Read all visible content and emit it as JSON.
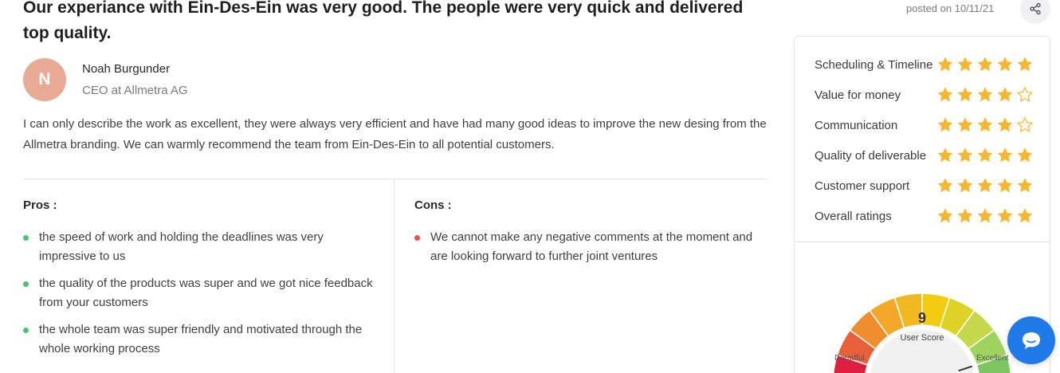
{
  "review": {
    "title": "Our experiance with Ein-Des-Ein was very good. The people were very quick and delivered top quality.",
    "posted": "posted on 10/11/21",
    "author": {
      "initial": "N",
      "name": "Noah Burgunder",
      "role": "CEO at Allmetra AG"
    },
    "body": "I can only describe the work as excellent, they were always very efficient and have had many good ideas to improve the new desing from the Allmetra branding. We can warmly recommend the team from Ein-Des-Ein to all potential customers.",
    "pros_title": "Pros :",
    "pros": [
      "the speed of work and holding the deadlines was very impressive to us",
      "the quality of the products was super and we got nice feedback from your customers",
      "the whole team was super friendly and motivated through the whole working process"
    ],
    "cons_title": "Cons :",
    "cons": [
      "We cannot make any negative comments at the moment and are looking forward to further joint ventures"
    ]
  },
  "ratings": [
    {
      "label": "Scheduling & Timeline",
      "stars": 5
    },
    {
      "label": "Value for money",
      "stars": 4
    },
    {
      "label": "Communication",
      "stars": 4
    },
    {
      "label": "Quality of deliverable",
      "stars": 5
    },
    {
      "label": "Customer support",
      "stars": 5
    },
    {
      "label": "Overall ratings",
      "stars": 5
    }
  ],
  "gauge": {
    "score": "9",
    "caption": "User Score",
    "min_label": "Dreadful",
    "max_label": "Excellent",
    "value": 9,
    "max": 10,
    "segment_colors": [
      "#de1f3d",
      "#e8603a",
      "#f08d2f",
      "#f3a82a",
      "#f2b821",
      "#f4cc0f",
      "#dcd325",
      "#c4d84a",
      "#9ed45e",
      "#7dc762"
    ]
  },
  "colors": {
    "star": "#f5b731",
    "pros_dot": "#4cc36a",
    "cons_dot": "#e4504a",
    "chat": "#1f7ae8"
  },
  "icons": {
    "share": "share-icon",
    "chat": "chat-bubble-icon",
    "star": "star-icon"
  }
}
